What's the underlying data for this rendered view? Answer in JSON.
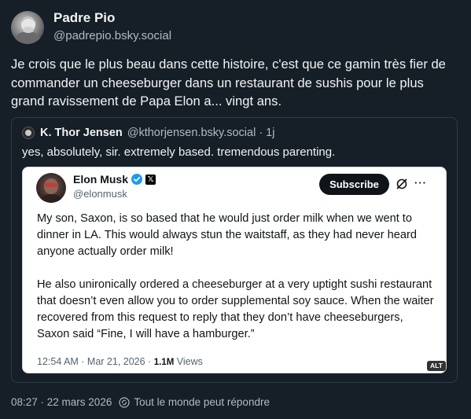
{
  "post": {
    "author": {
      "display_name": "Padre Pio",
      "handle": "@padrepio.bsky.social",
      "avatar_icon": "avatar-photo"
    },
    "text": "Je crois que le plus beau dans cette histoire, c'est que ce gamin très fier de commander un cheeseburger dans un restaurant de sushis pour le plus grand ravissement de Papa Elon a... vingt ans.",
    "timestamp": "08:27 · 22 mars 2026",
    "reply_setting": "Tout le monde peut répondre"
  },
  "quote": {
    "author": {
      "display_name": "K. Thor Jensen",
      "handle": "@kthorjensen.bsky.social",
      "separator": "·",
      "time": "1j"
    },
    "text": "yes, absolutely, sir. extremely based. tremendous parenting.",
    "embed": {
      "author": {
        "display_name": "Elon Musk",
        "handle": "@elonmusk"
      },
      "subscribe_label": "Subscribe",
      "more_label": "···",
      "x_badge": "𝕏",
      "paragraphs": [
        "My son, Saxon, is so based that he would just order milk when we went to dinner in LA. This would always stun the waitstaff, as they had never heard anyone actually order milk!",
        "He also unironically ordered a cheeseburger at a very uptight sushi restaurant that doesn’t even allow you to order supplemental soy sauce. When the waiter recovered from this request to reply that they don’t have cheeseburgers, Saxon said “Fine, I will have a hamburger.”"
      ],
      "meta": {
        "timestamp": "12:54 AM · Mar 21, 2026 · ",
        "views_count": "1.1M",
        "views_label": " Views"
      },
      "alt_badge": "ALT"
    }
  },
  "colors": {
    "background": "#161e27",
    "text": "#f1f3f5",
    "muted": "#aebbc9",
    "border": "#2e3b4b",
    "verified": "#1d9bf0"
  }
}
